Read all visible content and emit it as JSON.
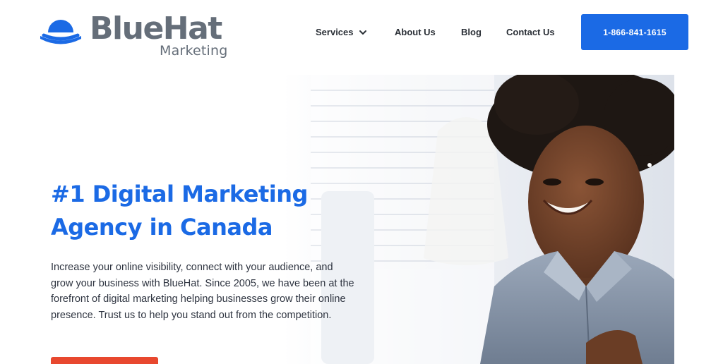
{
  "brand": {
    "name": "BlueHat",
    "sub": "Marketing",
    "primary_color": "#1b6ae5",
    "logo_text_color": "#656e79",
    "logo_icon": "hat-icon"
  },
  "nav": {
    "services": "Services",
    "services_icon": "chevron-down-icon",
    "about": "About Us",
    "blog": "Blog",
    "contact": "Contact Us",
    "phone": "1-866-841-1615"
  },
  "hero": {
    "headline_line1": "#1 Digital Marketing",
    "headline_line2": "Agency in Canada",
    "body": "Increase your online visibility, connect with your audience, and grow your business with BlueHat. Since 2005, we have been at the forefront of digital marketing helping businesses grow their online presence. Trust us to help you stand out from the competition.",
    "cta_color": "#e8482f",
    "image": "smiling-woman-photo"
  }
}
